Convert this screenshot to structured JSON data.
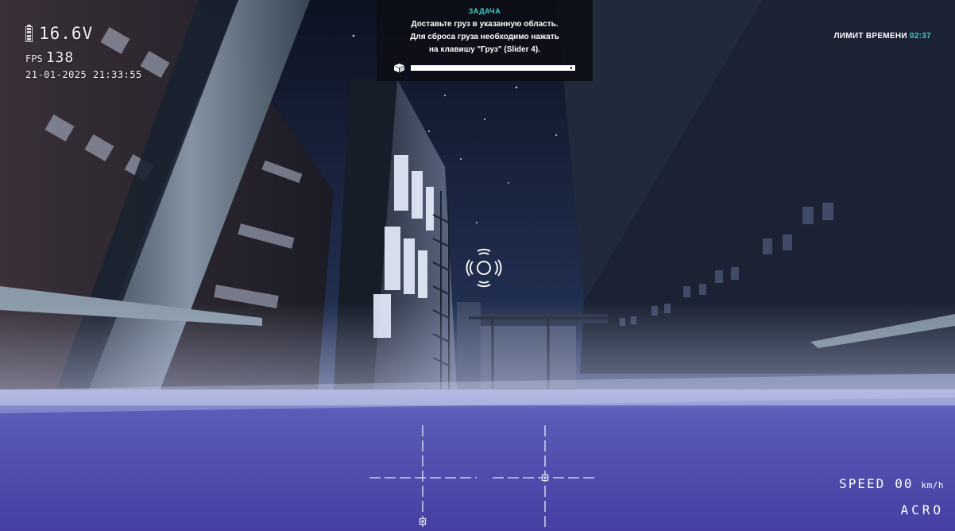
{
  "hud": {
    "battery_voltage": "16.6V",
    "fps_label": "FPS",
    "fps_value": "138",
    "datetime": "21-01-2025 21:33:55"
  },
  "task": {
    "title": "ЗАДАЧА",
    "line1": "Доставьте груз в указанную область.",
    "line2": "Для сброса груза необходимо нажать",
    "line3": "на клавишу \"Груз\" (Slider 4).",
    "cargo_icon": "cargo-box-icon",
    "progress": 1.0
  },
  "time_limit": {
    "label": "ЛИМИТ ВРЕМЕНИ",
    "value": "02:37"
  },
  "speed": {
    "label": "SPEED",
    "value": "00",
    "unit": "km/h"
  },
  "flight_mode": "ACRO",
  "colors": {
    "accent": "#3fd0c8",
    "hud_text": "#ffffff",
    "ground": "#4a48a8",
    "sky": "#151b2e"
  }
}
